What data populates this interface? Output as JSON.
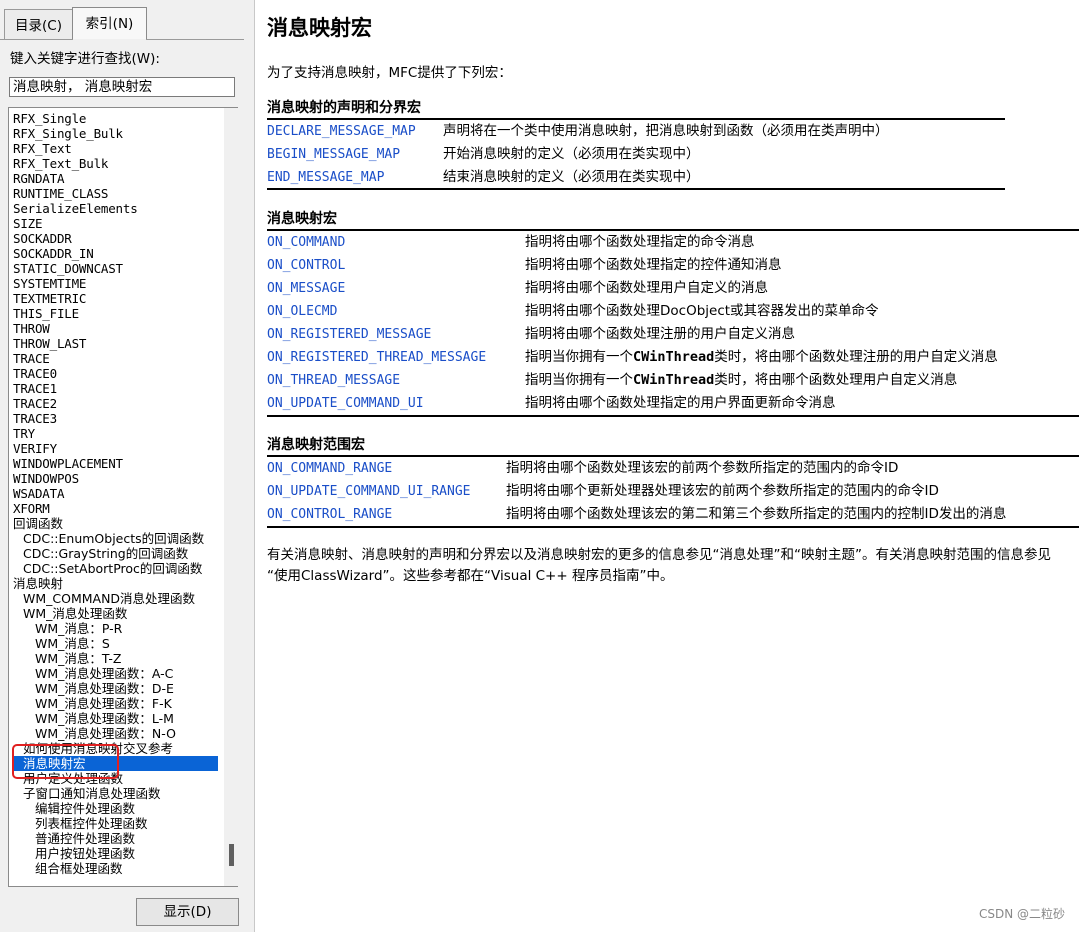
{
  "left": {
    "tabs": [
      {
        "label": "目录(C)"
      },
      {
        "label": "索引(N)"
      }
    ],
    "search_label": "键入关键字进行查找(W):",
    "search_value": "消息映射， 消息映射宏",
    "display_button": "显示(D)",
    "index_items": [
      {
        "text": "RFX_Single",
        "indent": 0,
        "cn": false
      },
      {
        "text": "RFX_Single_Bulk",
        "indent": 0,
        "cn": false
      },
      {
        "text": "RFX_Text",
        "indent": 0,
        "cn": false
      },
      {
        "text": "RFX_Text_Bulk",
        "indent": 0,
        "cn": false
      },
      {
        "text": "RGNDATA",
        "indent": 0,
        "cn": false
      },
      {
        "text": "RUNTIME_CLASS",
        "indent": 0,
        "cn": false
      },
      {
        "text": "SerializeElements",
        "indent": 0,
        "cn": false
      },
      {
        "text": "SIZE",
        "indent": 0,
        "cn": false
      },
      {
        "text": "SOCKADDR",
        "indent": 0,
        "cn": false
      },
      {
        "text": "SOCKADDR_IN",
        "indent": 0,
        "cn": false
      },
      {
        "text": "STATIC_DOWNCAST",
        "indent": 0,
        "cn": false
      },
      {
        "text": "SYSTEMTIME",
        "indent": 0,
        "cn": false
      },
      {
        "text": "TEXTMETRIC",
        "indent": 0,
        "cn": false
      },
      {
        "text": "THIS_FILE",
        "indent": 0,
        "cn": false
      },
      {
        "text": "THROW",
        "indent": 0,
        "cn": false
      },
      {
        "text": "THROW_LAST",
        "indent": 0,
        "cn": false
      },
      {
        "text": "TRACE",
        "indent": 0,
        "cn": false
      },
      {
        "text": "TRACE0",
        "indent": 0,
        "cn": false
      },
      {
        "text": "TRACE1",
        "indent": 0,
        "cn": false
      },
      {
        "text": "TRACE2",
        "indent": 0,
        "cn": false
      },
      {
        "text": "TRACE3",
        "indent": 0,
        "cn": false
      },
      {
        "text": "TRY",
        "indent": 0,
        "cn": false
      },
      {
        "text": "VERIFY",
        "indent": 0,
        "cn": false
      },
      {
        "text": "WINDOWPLACEMENT",
        "indent": 0,
        "cn": false
      },
      {
        "text": "WINDOWPOS",
        "indent": 0,
        "cn": false
      },
      {
        "text": "WSADATA",
        "indent": 0,
        "cn": false
      },
      {
        "text": "XFORM",
        "indent": 0,
        "cn": false
      },
      {
        "text": "回调函数",
        "indent": 0,
        "cn": true
      },
      {
        "text": "CDC::EnumObjects的回调函数",
        "indent": 1,
        "cn": true
      },
      {
        "text": "CDC::GrayString的回调函数",
        "indent": 1,
        "cn": true
      },
      {
        "text": "CDC::SetAbortProc的回调函数",
        "indent": 1,
        "cn": true
      },
      {
        "text": "消息映射",
        "indent": 0,
        "cn": true
      },
      {
        "text": "WM_COMMAND消息处理函数",
        "indent": 1,
        "cn": true
      },
      {
        "text": "WM_消息处理函数",
        "indent": 1,
        "cn": true
      },
      {
        "text": "WM_消息：P-R",
        "indent": 2,
        "cn": true
      },
      {
        "text": "WM_消息：S",
        "indent": 2,
        "cn": true
      },
      {
        "text": "WM_消息：T-Z",
        "indent": 2,
        "cn": true
      },
      {
        "text": "WM_消息处理函数：A-C",
        "indent": 2,
        "cn": true
      },
      {
        "text": "WM_消息处理函数：D-E",
        "indent": 2,
        "cn": true
      },
      {
        "text": "WM_消息处理函数：F-K",
        "indent": 2,
        "cn": true
      },
      {
        "text": "WM_消息处理函数：L-M",
        "indent": 2,
        "cn": true
      },
      {
        "text": "WM_消息处理函数：N-O",
        "indent": 2,
        "cn": true
      },
      {
        "text": "如何使用消息映射交叉参考",
        "indent": 1,
        "cn": true
      },
      {
        "text": "消息映射宏",
        "indent": 1,
        "cn": true,
        "selected": true
      },
      {
        "text": "用户定义处理函数",
        "indent": 1,
        "cn": true
      },
      {
        "text": "子窗口通知消息处理函数",
        "indent": 1,
        "cn": true
      },
      {
        "text": "编辑控件处理函数",
        "indent": 2,
        "cn": true
      },
      {
        "text": "列表框控件处理函数",
        "indent": 2,
        "cn": true
      },
      {
        "text": "普通控件处理函数",
        "indent": 2,
        "cn": true
      },
      {
        "text": "用户按钮处理函数",
        "indent": 2,
        "cn": true
      },
      {
        "text": "组合框处理函数",
        "indent": 2,
        "cn": true
      }
    ]
  },
  "content": {
    "title": "消息映射宏",
    "intro": "为了支持消息映射，MFC提供了下列宏：",
    "sections": [
      {
        "heading": "消息映射的声明和分界宏",
        "rows": [
          {
            "link": "DECLARE_MESSAGE_MAP",
            "desc": "声明将在一个类中使用消息映射，把消息映射到函数（必须用在类声明中）"
          },
          {
            "link": "BEGIN_MESSAGE_MAP",
            "desc": "开始消息映射的定义（必须用在类实现中）"
          },
          {
            "link": "END_MESSAGE_MAP",
            "desc": "结束消息映射的定义（必须用在类实现中）"
          }
        ]
      },
      {
        "heading": "消息映射宏",
        "rows": [
          {
            "link": "ON_COMMAND",
            "desc": "指明将由哪个函数处理指定的命令消息"
          },
          {
            "link": "ON_CONTROL",
            "desc": "指明将由哪个函数处理指定的控件通知消息"
          },
          {
            "link": "ON_MESSAGE",
            "desc": "指明将由哪个函数处理用户自定义的消息"
          },
          {
            "link": "ON_OLECMD",
            "desc": "指明将由哪个函数处理DocObject或其容器发出的菜单命令"
          },
          {
            "link": "ON_REGISTERED_MESSAGE",
            "desc": "指明将由哪个函数处理注册的用户自定义消息"
          },
          {
            "link": "ON_REGISTERED_THREAD_MESSAGE",
            "desc_pre": "指明当你拥有一个",
            "desc_bold": "CWinThread",
            "desc_post": "类时，将由哪个函数处理注册的用户自定义消息"
          },
          {
            "link": "ON_THREAD_MESSAGE",
            "desc_pre": "指明当你拥有一个",
            "desc_bold": "CWinThread",
            "desc_post": "类时，将由哪个函数处理用户自定义消息"
          },
          {
            "link": "ON_UPDATE_COMMAND_UI",
            "desc": "指明将由哪个函数处理指定的用户界面更新命令消息"
          }
        ]
      },
      {
        "heading": "消息映射范围宏",
        "rows": [
          {
            "link": "ON_COMMAND_RANGE",
            "desc": "指明将由哪个函数处理该宏的前两个参数所指定的范围内的命令ID"
          },
          {
            "link": "ON_UPDATE_COMMAND_UI_RANGE",
            "desc": "指明将由哪个更新处理器处理该宏的前两个参数所指定的范围内的命令ID"
          },
          {
            "link": "ON_CONTROL_RANGE",
            "desc": "指明将由哪个函数处理该宏的第二和第三个参数所指定的范围内的控制ID发出的消息"
          }
        ]
      }
    ],
    "footer_line1": "有关消息映射、消息映射的声明和分界宏以及消息映射宏的更多的信息参见“消息处理”和“映射主题”。有关消息映射范围的信息参见",
    "footer_line2": "“使用ClassWizard”。这些参考都在“Visual C++ 程序员指南”中。",
    "watermark": "CSDN @二粒砂"
  },
  "colors": {
    "link": "#1a4ec8",
    "selection": "#0a64d6",
    "highlight_box": "#e02020"
  }
}
